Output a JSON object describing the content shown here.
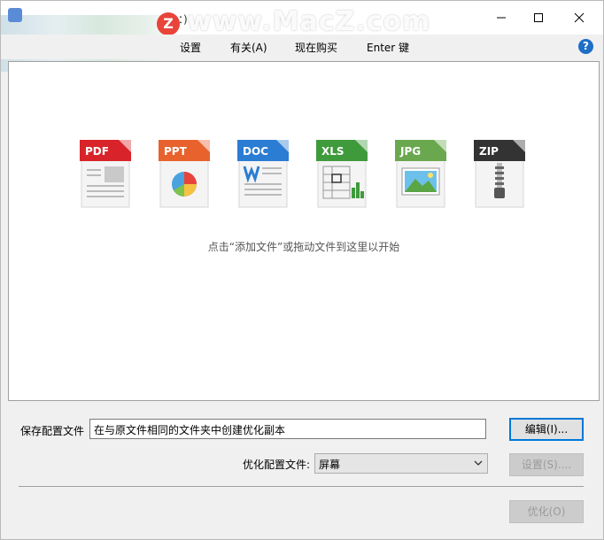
{
  "window": {
    "title": "：)",
    "watermark": "www.MacZ.com",
    "watermark_logo": "Z"
  },
  "menu": {
    "items": [
      {
        "label": "设置"
      },
      {
        "label": "有关(A)"
      },
      {
        "label": "现在购买"
      },
      {
        "label": "Enter 键"
      }
    ],
    "help": "?"
  },
  "filetypes": [
    {
      "label": "PDF",
      "color": "#d8232a"
    },
    {
      "label": "PPT",
      "color": "#e8622d"
    },
    {
      "label": "DOC",
      "color": "#2b7cd3"
    },
    {
      "label": "XLS",
      "color": "#3f9a3c"
    },
    {
      "label": "JPG",
      "color": "#6aa84f"
    },
    {
      "label": "ZIP",
      "color": "#333333"
    }
  ],
  "dropzone": {
    "hint": "点击“添加文件”或拖动文件到这里以开始"
  },
  "bottom": {
    "save_label": "保存配置文件",
    "save_value": "在与原文件相同的文件夹中创建优化副本",
    "edit_button": "编辑(I)...",
    "profile_label": "优化配置文件:",
    "profile_value": "屏幕",
    "settings_button": "设置(S)....",
    "optimize_button": "优化(O)"
  }
}
